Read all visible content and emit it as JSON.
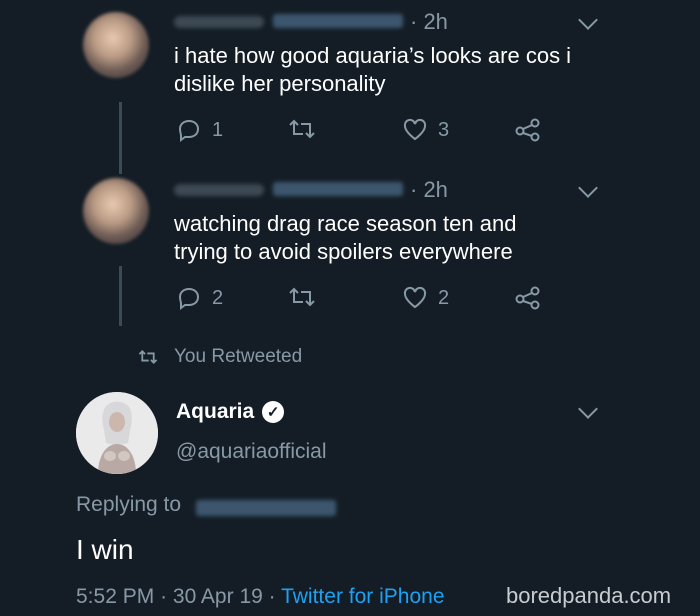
{
  "tweets": [
    {
      "time": "· 2h",
      "text_line1": "i hate how good aquaria’s looks are cos i",
      "text_line2": "dislike her personality",
      "reply_count": "1",
      "like_count": "3"
    },
    {
      "time": "· 2h",
      "text_line1": "watching drag race season ten and",
      "text_line2": "trying to avoid spoilers everywhere",
      "reply_count": "2",
      "like_count": "2"
    }
  ],
  "retweet_notice": "You Retweeted",
  "main_tweet": {
    "display_name": "Aquaria",
    "handle": "@aquariaofficial",
    "replying_to": "Replying to",
    "text": "I win",
    "timestamp": "5:52 PM",
    "date": "30 Apr 19",
    "source": "Twitter for iPhone"
  },
  "watermark": "boredpanda.com",
  "colors": {
    "background": "#141d26",
    "muted": "#8899a6",
    "link": "#1da1f2"
  }
}
